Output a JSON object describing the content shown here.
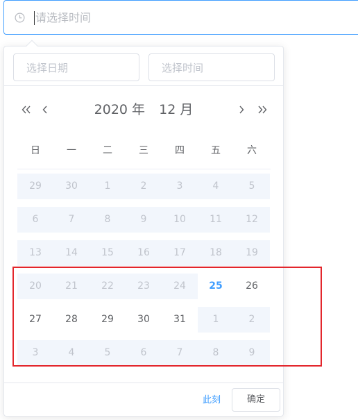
{
  "main_input": {
    "placeholder": "请选择时间",
    "icon": "clock-icon",
    "focus_color": "#409eff"
  },
  "picker": {
    "date_input_placeholder": "选择日期",
    "time_input_placeholder": "选择时间",
    "header": {
      "year": "2020 年",
      "month": "12 月"
    },
    "weekdays": [
      "日",
      "一",
      "二",
      "三",
      "四",
      "五",
      "六"
    ],
    "weeks": [
      [
        {
          "d": "29",
          "m": true
        },
        {
          "d": "30",
          "m": true
        },
        {
          "d": "1",
          "m": true
        },
        {
          "d": "2",
          "m": true
        },
        {
          "d": "3",
          "m": true
        },
        {
          "d": "4",
          "m": true
        },
        {
          "d": "5",
          "m": true
        }
      ],
      [
        {
          "d": "6",
          "m": true
        },
        {
          "d": "7",
          "m": true
        },
        {
          "d": "8",
          "m": true
        },
        {
          "d": "9",
          "m": true
        },
        {
          "d": "10",
          "m": true
        },
        {
          "d": "11",
          "m": true
        },
        {
          "d": "12",
          "m": true
        }
      ],
      [
        {
          "d": "13",
          "m": true
        },
        {
          "d": "14",
          "m": true
        },
        {
          "d": "15",
          "m": true
        },
        {
          "d": "16",
          "m": true
        },
        {
          "d": "17",
          "m": true
        },
        {
          "d": "18",
          "m": true
        },
        {
          "d": "19",
          "m": true
        }
      ],
      [
        {
          "d": "20",
          "m": true
        },
        {
          "d": "21",
          "m": true
        },
        {
          "d": "22",
          "m": true
        },
        {
          "d": "23",
          "m": true
        },
        {
          "d": "24",
          "m": true
        },
        {
          "d": "25",
          "m": false,
          "today": true
        },
        {
          "d": "26",
          "m": false
        }
      ],
      [
        {
          "d": "27",
          "m": false
        },
        {
          "d": "28",
          "m": false
        },
        {
          "d": "29",
          "m": false
        },
        {
          "d": "30",
          "m": false
        },
        {
          "d": "31",
          "m": false
        },
        {
          "d": "1",
          "m": true
        },
        {
          "d": "2",
          "m": true
        }
      ],
      [
        {
          "d": "3",
          "m": true
        },
        {
          "d": "4",
          "m": true
        },
        {
          "d": "5",
          "m": true
        },
        {
          "d": "6",
          "m": true
        },
        {
          "d": "7",
          "m": true
        },
        {
          "d": "8",
          "m": true
        },
        {
          "d": "9",
          "m": true
        }
      ]
    ],
    "footer": {
      "now_label": "此刻",
      "confirm_label": "确定"
    }
  },
  "colors": {
    "accent": "#409eff",
    "disabled_bg": "#f2f6fc",
    "muted_text": "#c0c4cc",
    "highlight_border": "#e3262c"
  }
}
